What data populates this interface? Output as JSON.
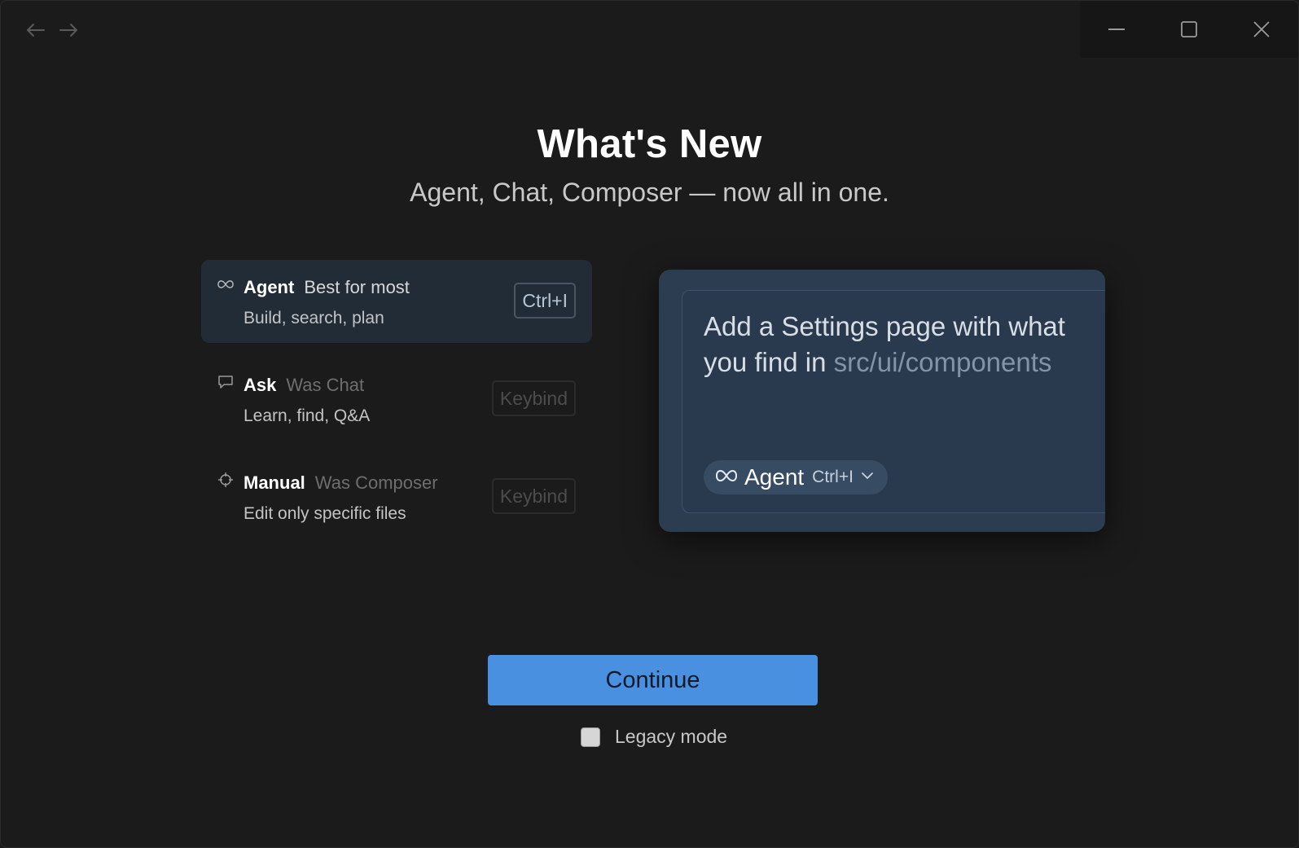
{
  "window": {
    "icons": {
      "back": "arrow-left-icon",
      "forward": "arrow-right-icon",
      "minimize": "minimize-icon",
      "maximize": "maximize-icon",
      "close": "close-icon"
    }
  },
  "header": {
    "title": "What's New",
    "subtitle": "Agent, Chat, Composer — now all in one."
  },
  "modes": [
    {
      "icon": "infinity-icon",
      "name": "Agent",
      "tag": "Best for most",
      "description": "Build, search, plan",
      "keybind": "Ctrl+I",
      "active": true
    },
    {
      "icon": "chat-bubble-icon",
      "name": "Ask",
      "tag": "Was Chat",
      "description": "Learn, find, Q&A",
      "keybind": "Keybind",
      "active": false
    },
    {
      "icon": "crosshair-icon",
      "name": "Manual",
      "tag": "Was Composer",
      "description": "Edit only specific files",
      "keybind": "Keybind",
      "active": false
    }
  ],
  "preview": {
    "prompt_text": "Add a Settings page with what you find in ",
    "prompt_path": "src/ui/components",
    "pill": {
      "icon": "infinity-icon",
      "label": "Agent",
      "shortcut": "Ctrl+I",
      "dropdown_icon": "chevron-down-icon"
    }
  },
  "footer": {
    "continue_label": "Continue",
    "legacy_label": "Legacy mode",
    "legacy_checked": false
  },
  "colors": {
    "background": "#1b1b1b",
    "accent": "#4a90e0",
    "active_mode_bg": "#222c37",
    "preview_bg": "#2c3d52"
  }
}
